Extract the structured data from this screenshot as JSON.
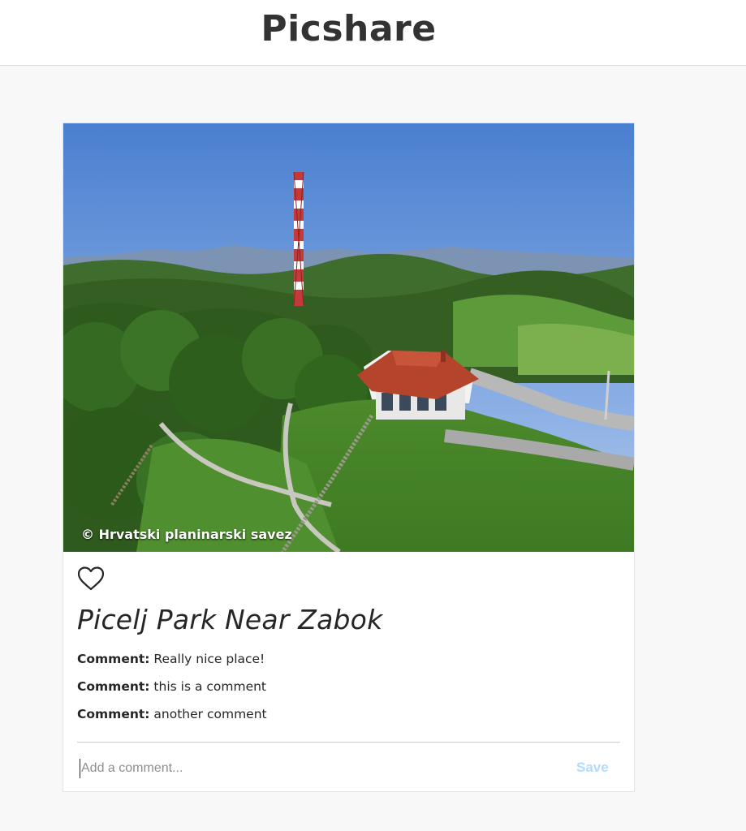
{
  "header": {
    "brand": "Picshare"
  },
  "post": {
    "image_credit": "© Hrvatski planinarski savez",
    "like_icon": "heart-outline-icon",
    "title": "Picelj Park Near Zabok",
    "comments": [
      {
        "label": "Comment:",
        "text": "Really nice place!"
      },
      {
        "label": "Comment:",
        "text": "this is a comment"
      },
      {
        "label": "Comment:",
        "text": "another comment"
      }
    ],
    "comment_input": {
      "placeholder": "Add a comment...",
      "value": ""
    },
    "save_label": "Save"
  },
  "colors": {
    "background": "#f8f8f8",
    "card": "#ffffff",
    "text": "#262626",
    "save_disabled": "#b3dbff",
    "brand_text": "#333333"
  }
}
